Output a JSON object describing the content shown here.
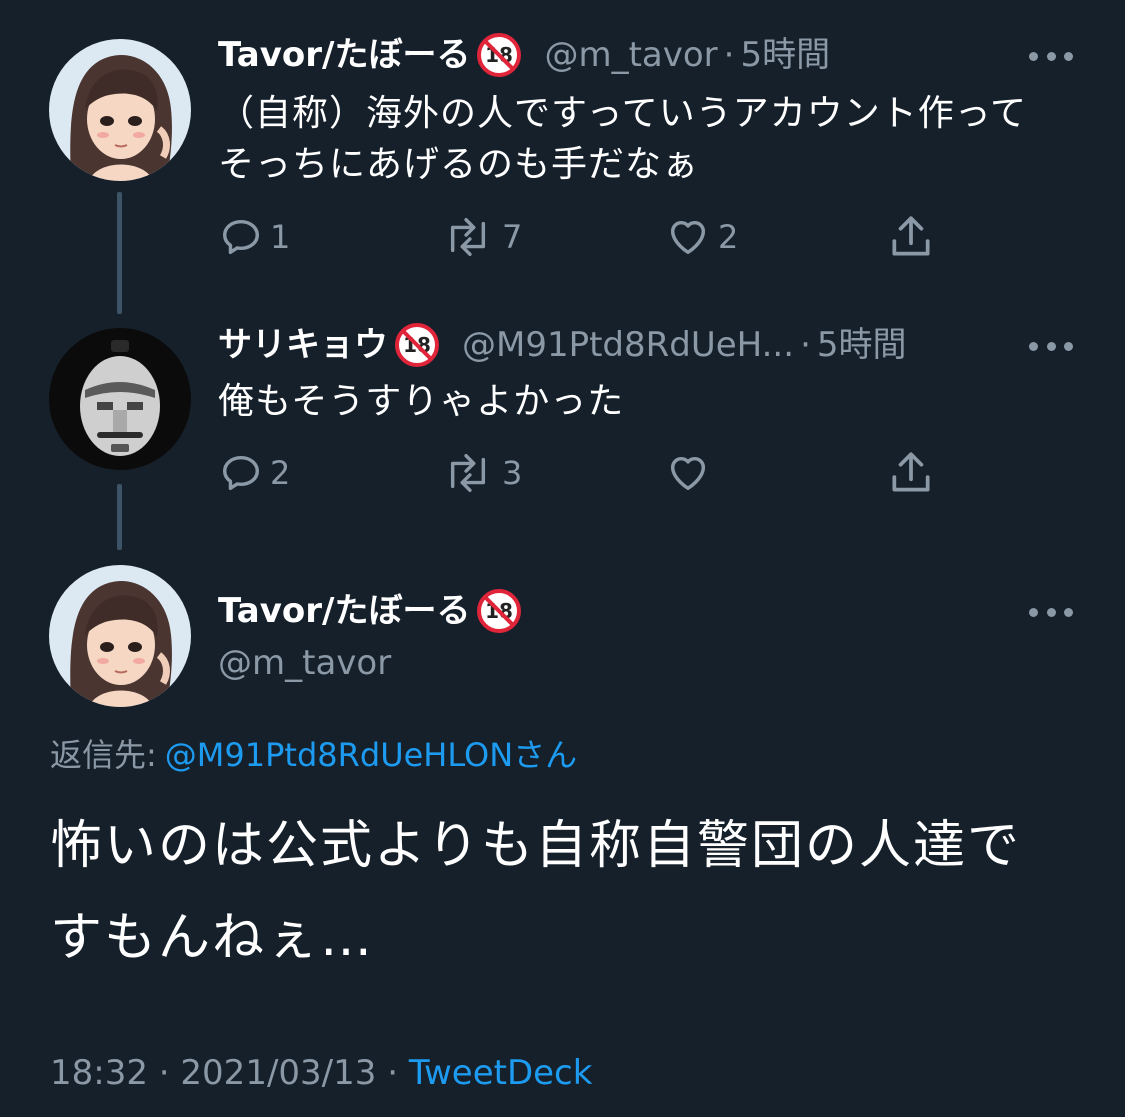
{
  "tweets": [
    {
      "display_name": "Tavor/たぼーる",
      "handle": "@m_tavor",
      "separator": "·",
      "time": "5時間",
      "text": "（自称）海外の人ですっていうアカウント作ってそっちにあげるのも手だなぁ",
      "replies": "1",
      "retweets": "7",
      "likes": "2"
    },
    {
      "display_name": "サリキョウ",
      "handle": "@M91Ptd8RdUeH...",
      "separator": "·",
      "time": "5時間",
      "text": "俺もそうすりゃよかった",
      "replies": "2",
      "retweets": "3",
      "likes": ""
    }
  ],
  "main_tweet": {
    "display_name": "Tavor/たぼーる",
    "handle": "@m_tavor",
    "reply_label": "返信先:",
    "reply_mention": "@M91Ptd8RdUeHLONさん",
    "text": "怖いのは公式よりも自称自警団の人達ですもんねぇ…",
    "time": "18:32",
    "separator": "·",
    "date": "2021/03/13",
    "source": "TweetDeck"
  },
  "badge_text": "18",
  "colors": {
    "background": "#15202b",
    "text": "#ffffff",
    "secondary": "#8b98a5",
    "link": "#1d9bf0",
    "thread_line": "#3d5466",
    "badge_red": "#e0243a"
  },
  "icons": [
    "reply-icon",
    "retweet-icon",
    "like-icon",
    "share-icon",
    "more-icon",
    "no-under-18-icon"
  ]
}
